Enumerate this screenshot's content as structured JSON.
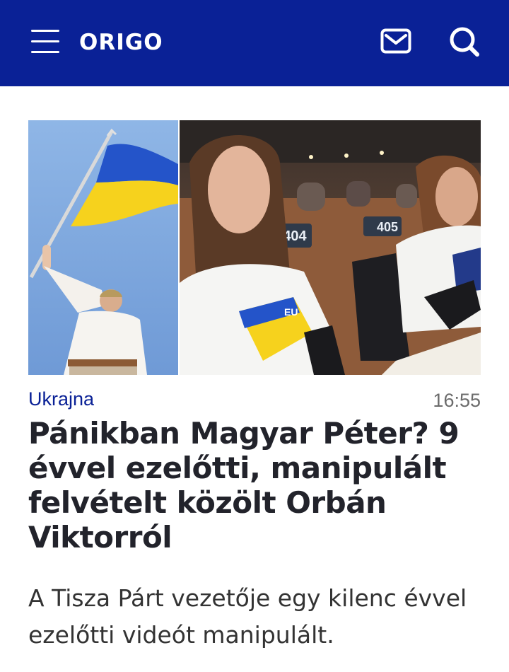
{
  "header": {
    "logo": "ORIGO",
    "menu_icon": "hamburger-menu-icon",
    "mail_icon": "mail-icon",
    "search_icon": "search-icon",
    "bg_color": "#0a2196"
  },
  "article": {
    "image": {
      "left_panel": "man-holding-ukrainian-flag",
      "right_panel": "women-in-parliament-ukraine-shirts",
      "seat_labels": [
        "404",
        "405"
      ],
      "shirt_text": "EU"
    },
    "category": "Ukrajna",
    "time": "16:55",
    "headline": "Pánikban Magyar Péter? 9 évvel ezelőtti, manipulált felvételt közölt Orbán Viktorról",
    "lead": "A Tisza Párt vezetője egy kilenc évvel ezelőtti videót manipulált.",
    "category_color": "#0a2196"
  }
}
